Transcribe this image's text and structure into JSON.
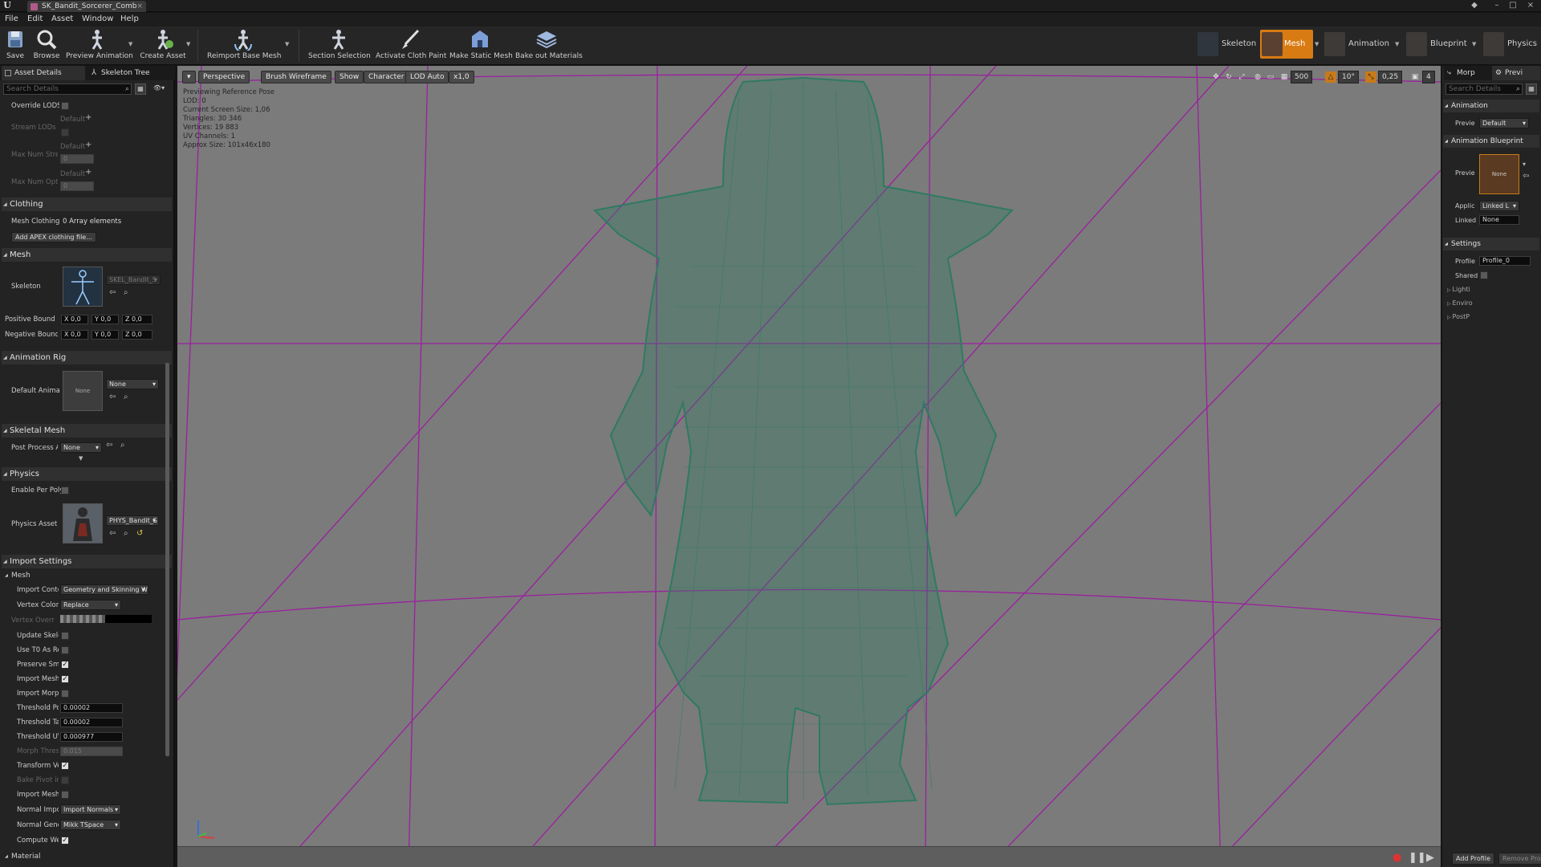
{
  "window": {
    "tab_title": "SK_Bandit_Sorcerer_Comb",
    "minimize": "–",
    "maximize": "□",
    "close": "×"
  },
  "menu": [
    "File",
    "Edit",
    "Asset",
    "Window",
    "Help"
  ],
  "toolbar": {
    "save": "Save",
    "browse": "Browse",
    "preview_animation": "Preview Animation",
    "create_asset": "Create Asset",
    "reimport": "Reimport Base Mesh",
    "section_selection": "Section Selection",
    "activate_cloth": "Activate Cloth Paint",
    "make_static": "Make Static Mesh",
    "bake_materials": "Bake out Materials"
  },
  "modes": {
    "skeleton": "Skeleton",
    "mesh": "Mesh",
    "animation": "Animation",
    "blueprint": "Blueprint",
    "physics": "Physics"
  },
  "left_panel": {
    "tab_asset_details": "Asset Details",
    "tab_skeleton_tree": "Skeleton Tree",
    "search_placeholder": "Search Details",
    "lod": {
      "override_lods": "Override LODSt",
      "stream_lods": "Stream LODs",
      "default1": "Default",
      "max_num_stre": "Max Num Stre",
      "default2": "Default",
      "max_num_stre_val": "0",
      "max_num_opti": "Max Num Optir",
      "default3": "Default",
      "max_num_opti_val": "0"
    },
    "clothing": {
      "header": "Clothing",
      "mesh_clothing": "Mesh Clothing",
      "mesh_clothing_val": "0 Array elements",
      "add_apex": "Add APEX clothing file..."
    },
    "mesh": {
      "header": "Mesh",
      "skeleton": "Skeleton",
      "skeleton_val": "SKEL_Bandit_S",
      "positive_bound": "Positive Bound",
      "negative_bound": "Negative Bound",
      "bx": "X 0,0",
      "by": "Y 0,0",
      "bz": "Z 0,0"
    },
    "anim_rig": {
      "header": "Animation Rig",
      "default_anim": "Default Animati",
      "none_thumb": "None",
      "combo": "None"
    },
    "skeletal_mesh": {
      "header": "Skeletal Mesh",
      "post_process": "Post Process A",
      "combo": "None"
    },
    "physics": {
      "header": "Physics",
      "enable_per_poly": "Enable Per Poly",
      "physics_asset": "Physics Asset",
      "physics_asset_val": "PHYS_Bandit_S"
    },
    "import_settings": {
      "header": "Import Settings",
      "mesh_sub": "Mesh",
      "import_content": "Import Conter",
      "import_content_val": "Geometry and Skinning W",
      "vertex_color": "Vertex Color I",
      "vertex_color_val": "Replace",
      "vertex_override": "Vertex Overr",
      "update_skeleton": "Update Skele",
      "use_t0": "Use T0 As Re",
      "preserve_smooth": "Preserve Smo",
      "import_meshes": "Import Meshe",
      "import_morph": "Import Morph",
      "threshold_pos": "Threshold Po",
      "threshold_pos_val": "0.00002",
      "threshold_tan": "Threshold Ta",
      "threshold_tan_val": "0.00002",
      "threshold_uv": "Threshold UV",
      "threshold_uv_val": "0.000977",
      "morph_thresh": "Morph Thresl",
      "morph_thresh_val": "0.015",
      "transform_ve": "Transform Ve",
      "bake_pivot": "Bake Pivot in",
      "import_mesh_lod": "Import Mesh",
      "normal_import": "Normal Impor",
      "normal_import_val": "Import Normals",
      "normal_gen": "Normal Gener",
      "normal_gen_val": "Mikk TSpace",
      "compute_weighted": "Compute Wei",
      "material_sub": "Material"
    }
  },
  "viewport": {
    "menu": "▾",
    "perspective": "Perspective",
    "brush_wireframe": "Brush Wireframe",
    "show": "Show",
    "character": "Character",
    "lod_auto": "LOD Auto",
    "speed": "x1,0",
    "grid_snap": "500",
    "rot_snap": "10°",
    "scale_snap": "0,25",
    "cam_speed": "4",
    "info": [
      "Previewing Reference Pose",
      "LOD: 0",
      "Current Screen Size: 1,06",
      "Triangles: 30 346",
      "Vertices: 19 883",
      "UV Channels: 1",
      "Approx Size: 101x46x180"
    ],
    "colors": {
      "background": "#7b7b7b",
      "grid": "#9b1fa0",
      "wireframe": "#2f7a62"
    }
  },
  "right_panel": {
    "tab_morph": "Morp",
    "tab_preview": "Previ",
    "search_placeholder": "Search Details",
    "animation": "Animation",
    "preview_label": "Previe",
    "preview_val": "Default",
    "anim_blueprint": "Animation Blueprint",
    "ab_preview": "Previe",
    "ab_none": "None",
    "applic": "Applic",
    "applic_val": "Linked L",
    "linked": "Linked",
    "linked_val": "None",
    "settings": "Settings",
    "profile": "Profile",
    "profile_val": "Profile_0",
    "shared": "Shared",
    "lighting": "Lighti",
    "environment": "Enviro",
    "postfx": "PostP",
    "add_profile": "Add Profile",
    "remove_profile": "Remove Profi"
  }
}
